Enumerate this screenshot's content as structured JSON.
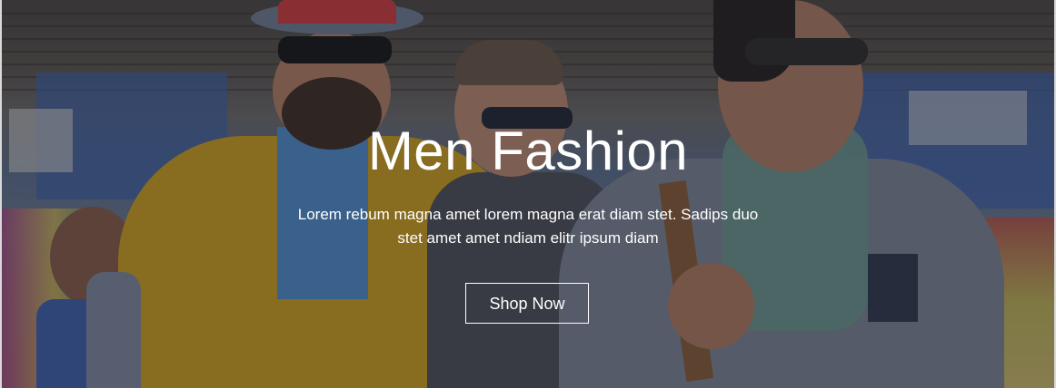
{
  "hero": {
    "title": "Men Fashion",
    "subtitle": "Lorem rebum magna amet lorem magna erat diam stet. Sadips duo stet amet amet ndiam elitr ipsum diam",
    "button_label": "Shop Now"
  },
  "colors": {
    "overlay": "#1e222a",
    "text": "#ffffff",
    "button_border": "#ffffff"
  }
}
